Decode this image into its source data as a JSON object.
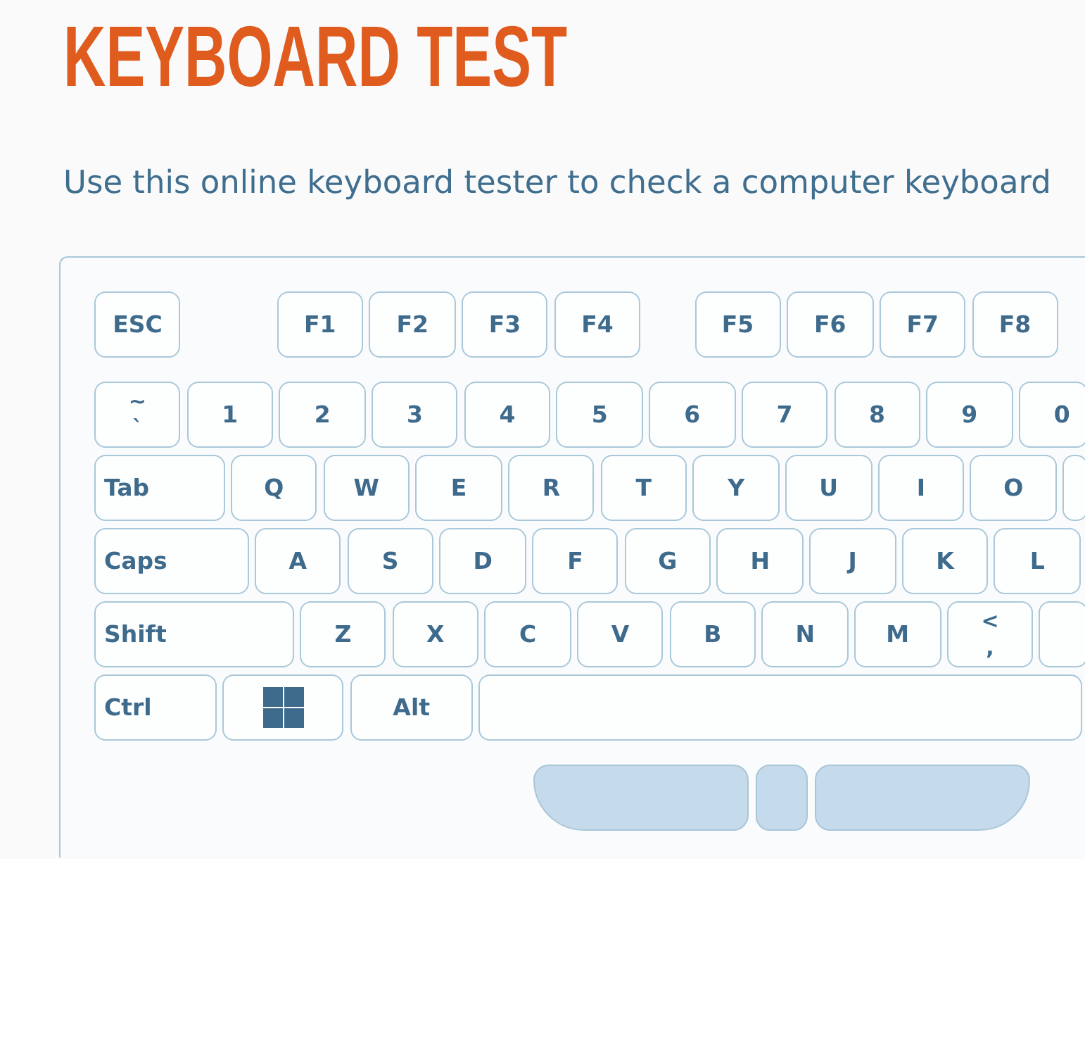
{
  "title": "KEYBOARD TEST",
  "intro": "Use this online keyboard tester to check a computer keyboard",
  "keyboard": {
    "function_groups": [
      {
        "keys": [
          {
            "kind": "char",
            "label": "ESC"
          }
        ]
      },
      {
        "keys": [
          {
            "kind": "char",
            "label": "F1"
          },
          {
            "kind": "char",
            "label": "F2"
          },
          {
            "kind": "char",
            "label": "F3"
          },
          {
            "kind": "char",
            "label": "F4"
          }
        ]
      },
      {
        "keys": [
          {
            "kind": "char",
            "label": "F5"
          },
          {
            "kind": "char",
            "label": "F6"
          },
          {
            "kind": "char",
            "label": "F7"
          },
          {
            "kind": "char",
            "label": "F8"
          }
        ]
      }
    ],
    "rows": [
      {
        "keys": [
          {
            "kind": "char",
            "shift_label": "~",
            "label": "`"
          },
          {
            "kind": "char",
            "label": "1"
          },
          {
            "kind": "char",
            "label": "2"
          },
          {
            "kind": "char",
            "label": "3"
          },
          {
            "kind": "char",
            "label": "4"
          },
          {
            "kind": "char",
            "label": "5"
          },
          {
            "kind": "char",
            "label": "6"
          },
          {
            "kind": "char",
            "label": "7"
          },
          {
            "kind": "char",
            "label": "8"
          },
          {
            "kind": "char",
            "label": "9"
          },
          {
            "kind": "char",
            "label": "0"
          }
        ]
      },
      {
        "keys": [
          {
            "kind": "tab",
            "label": "Tab"
          },
          {
            "kind": "char",
            "label": "Q"
          },
          {
            "kind": "char",
            "label": "W"
          },
          {
            "kind": "char",
            "label": "E"
          },
          {
            "kind": "char",
            "label": "R"
          },
          {
            "kind": "char",
            "label": "T"
          },
          {
            "kind": "char",
            "label": "Y"
          },
          {
            "kind": "char",
            "label": "U"
          },
          {
            "kind": "char",
            "label": "I"
          },
          {
            "kind": "char",
            "label": "O"
          },
          {
            "kind": "char"
          }
        ]
      },
      {
        "keys": [
          {
            "kind": "caps",
            "label": "Caps"
          },
          {
            "kind": "char",
            "label": "A"
          },
          {
            "kind": "char",
            "label": "S"
          },
          {
            "kind": "char",
            "label": "D"
          },
          {
            "kind": "char",
            "label": "F"
          },
          {
            "kind": "char",
            "label": "G"
          },
          {
            "kind": "char",
            "label": "H"
          },
          {
            "kind": "char",
            "label": "J"
          },
          {
            "kind": "char",
            "label": "K"
          },
          {
            "kind": "char",
            "label": "L"
          }
        ]
      },
      {
        "keys": [
          {
            "kind": "shift",
            "label": "Shift"
          },
          {
            "kind": "char",
            "label": "Z"
          },
          {
            "kind": "char",
            "label": "X"
          },
          {
            "kind": "char",
            "label": "C"
          },
          {
            "kind": "char",
            "label": "V"
          },
          {
            "kind": "char",
            "label": "B"
          },
          {
            "kind": "char",
            "label": "N"
          },
          {
            "kind": "char",
            "label": "M"
          },
          {
            "kind": "char",
            "shift_label": "<",
            "label": ","
          },
          {
            "kind": "char"
          }
        ]
      },
      {
        "keys": [
          {
            "kind": "ctrl",
            "label": "Ctrl"
          },
          {
            "kind": "windows"
          },
          {
            "kind": "alt",
            "label": "Alt"
          },
          {
            "kind": "space"
          }
        ]
      }
    ]
  }
}
